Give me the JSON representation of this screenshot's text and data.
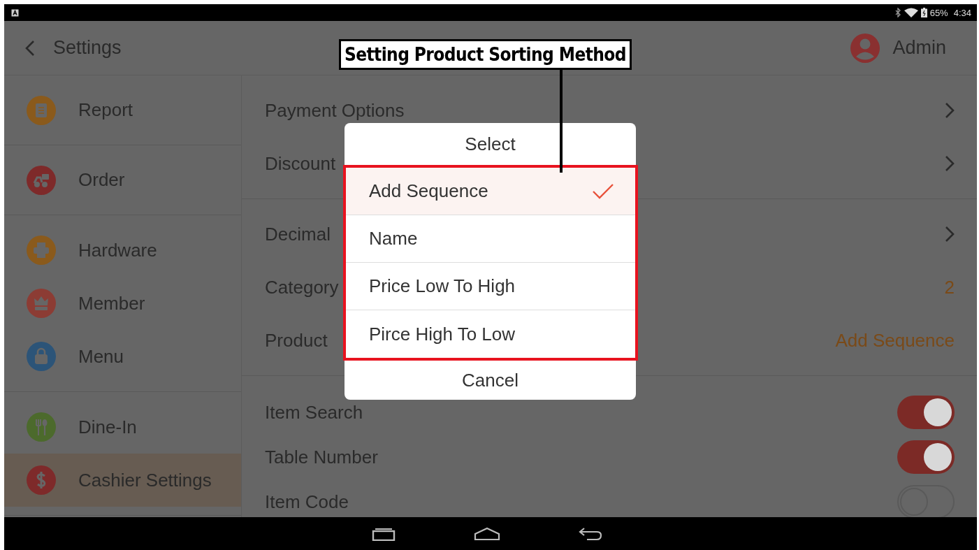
{
  "status_bar": {
    "battery": "65%",
    "time": "4:34"
  },
  "header": {
    "back_label": "Settings",
    "user": "Admin"
  },
  "sidebar": {
    "groups": [
      {
        "items": [
          {
            "label": "Report",
            "color": "#8a5a1c",
            "selected": false
          }
        ]
      },
      {
        "items": [
          {
            "label": "Order",
            "color": "#7e2a2a",
            "selected": false
          }
        ]
      },
      {
        "items": [
          {
            "label": "Hardware",
            "color": "#8a5a1c",
            "selected": false
          },
          {
            "label": "Member",
            "color": "#8c3c34",
            "selected": false
          },
          {
            "label": "Menu",
            "color": "#2c5478",
            "selected": false
          }
        ]
      },
      {
        "items": [
          {
            "label": "Dine-In",
            "color": "#4c6a2c",
            "selected": false
          },
          {
            "label": "Cashier Settings",
            "color": "#7e2a2a",
            "selected": true
          }
        ]
      }
    ]
  },
  "settings": {
    "groups": [
      {
        "rows": [
          {
            "kind": "link",
            "label": "Payment Options"
          },
          {
            "kind": "link",
            "label": "Discount"
          }
        ]
      },
      {
        "rows": [
          {
            "kind": "link",
            "label": "Decimal"
          },
          {
            "kind": "value",
            "label": "Category",
            "value": "2"
          },
          {
            "kind": "value",
            "label": "Product",
            "value": "Add Sequence"
          }
        ]
      },
      {
        "rows": [
          {
            "kind": "toggle",
            "label": "Item Search",
            "on": true
          },
          {
            "kind": "toggle",
            "label": "Table Number",
            "on": true
          },
          {
            "kind": "toggle",
            "label": "Item Code",
            "on": false
          }
        ]
      }
    ]
  },
  "dialog": {
    "title": "Select",
    "options": [
      {
        "label": "Add Sequence",
        "selected": true
      },
      {
        "label": "Name",
        "selected": false
      },
      {
        "label": "Price Low To High",
        "selected": false
      },
      {
        "label": "Pirce High To Low",
        "selected": false
      }
    ],
    "cancel": "Cancel"
  },
  "annotation": {
    "label": "Setting Product Sorting Method"
  }
}
